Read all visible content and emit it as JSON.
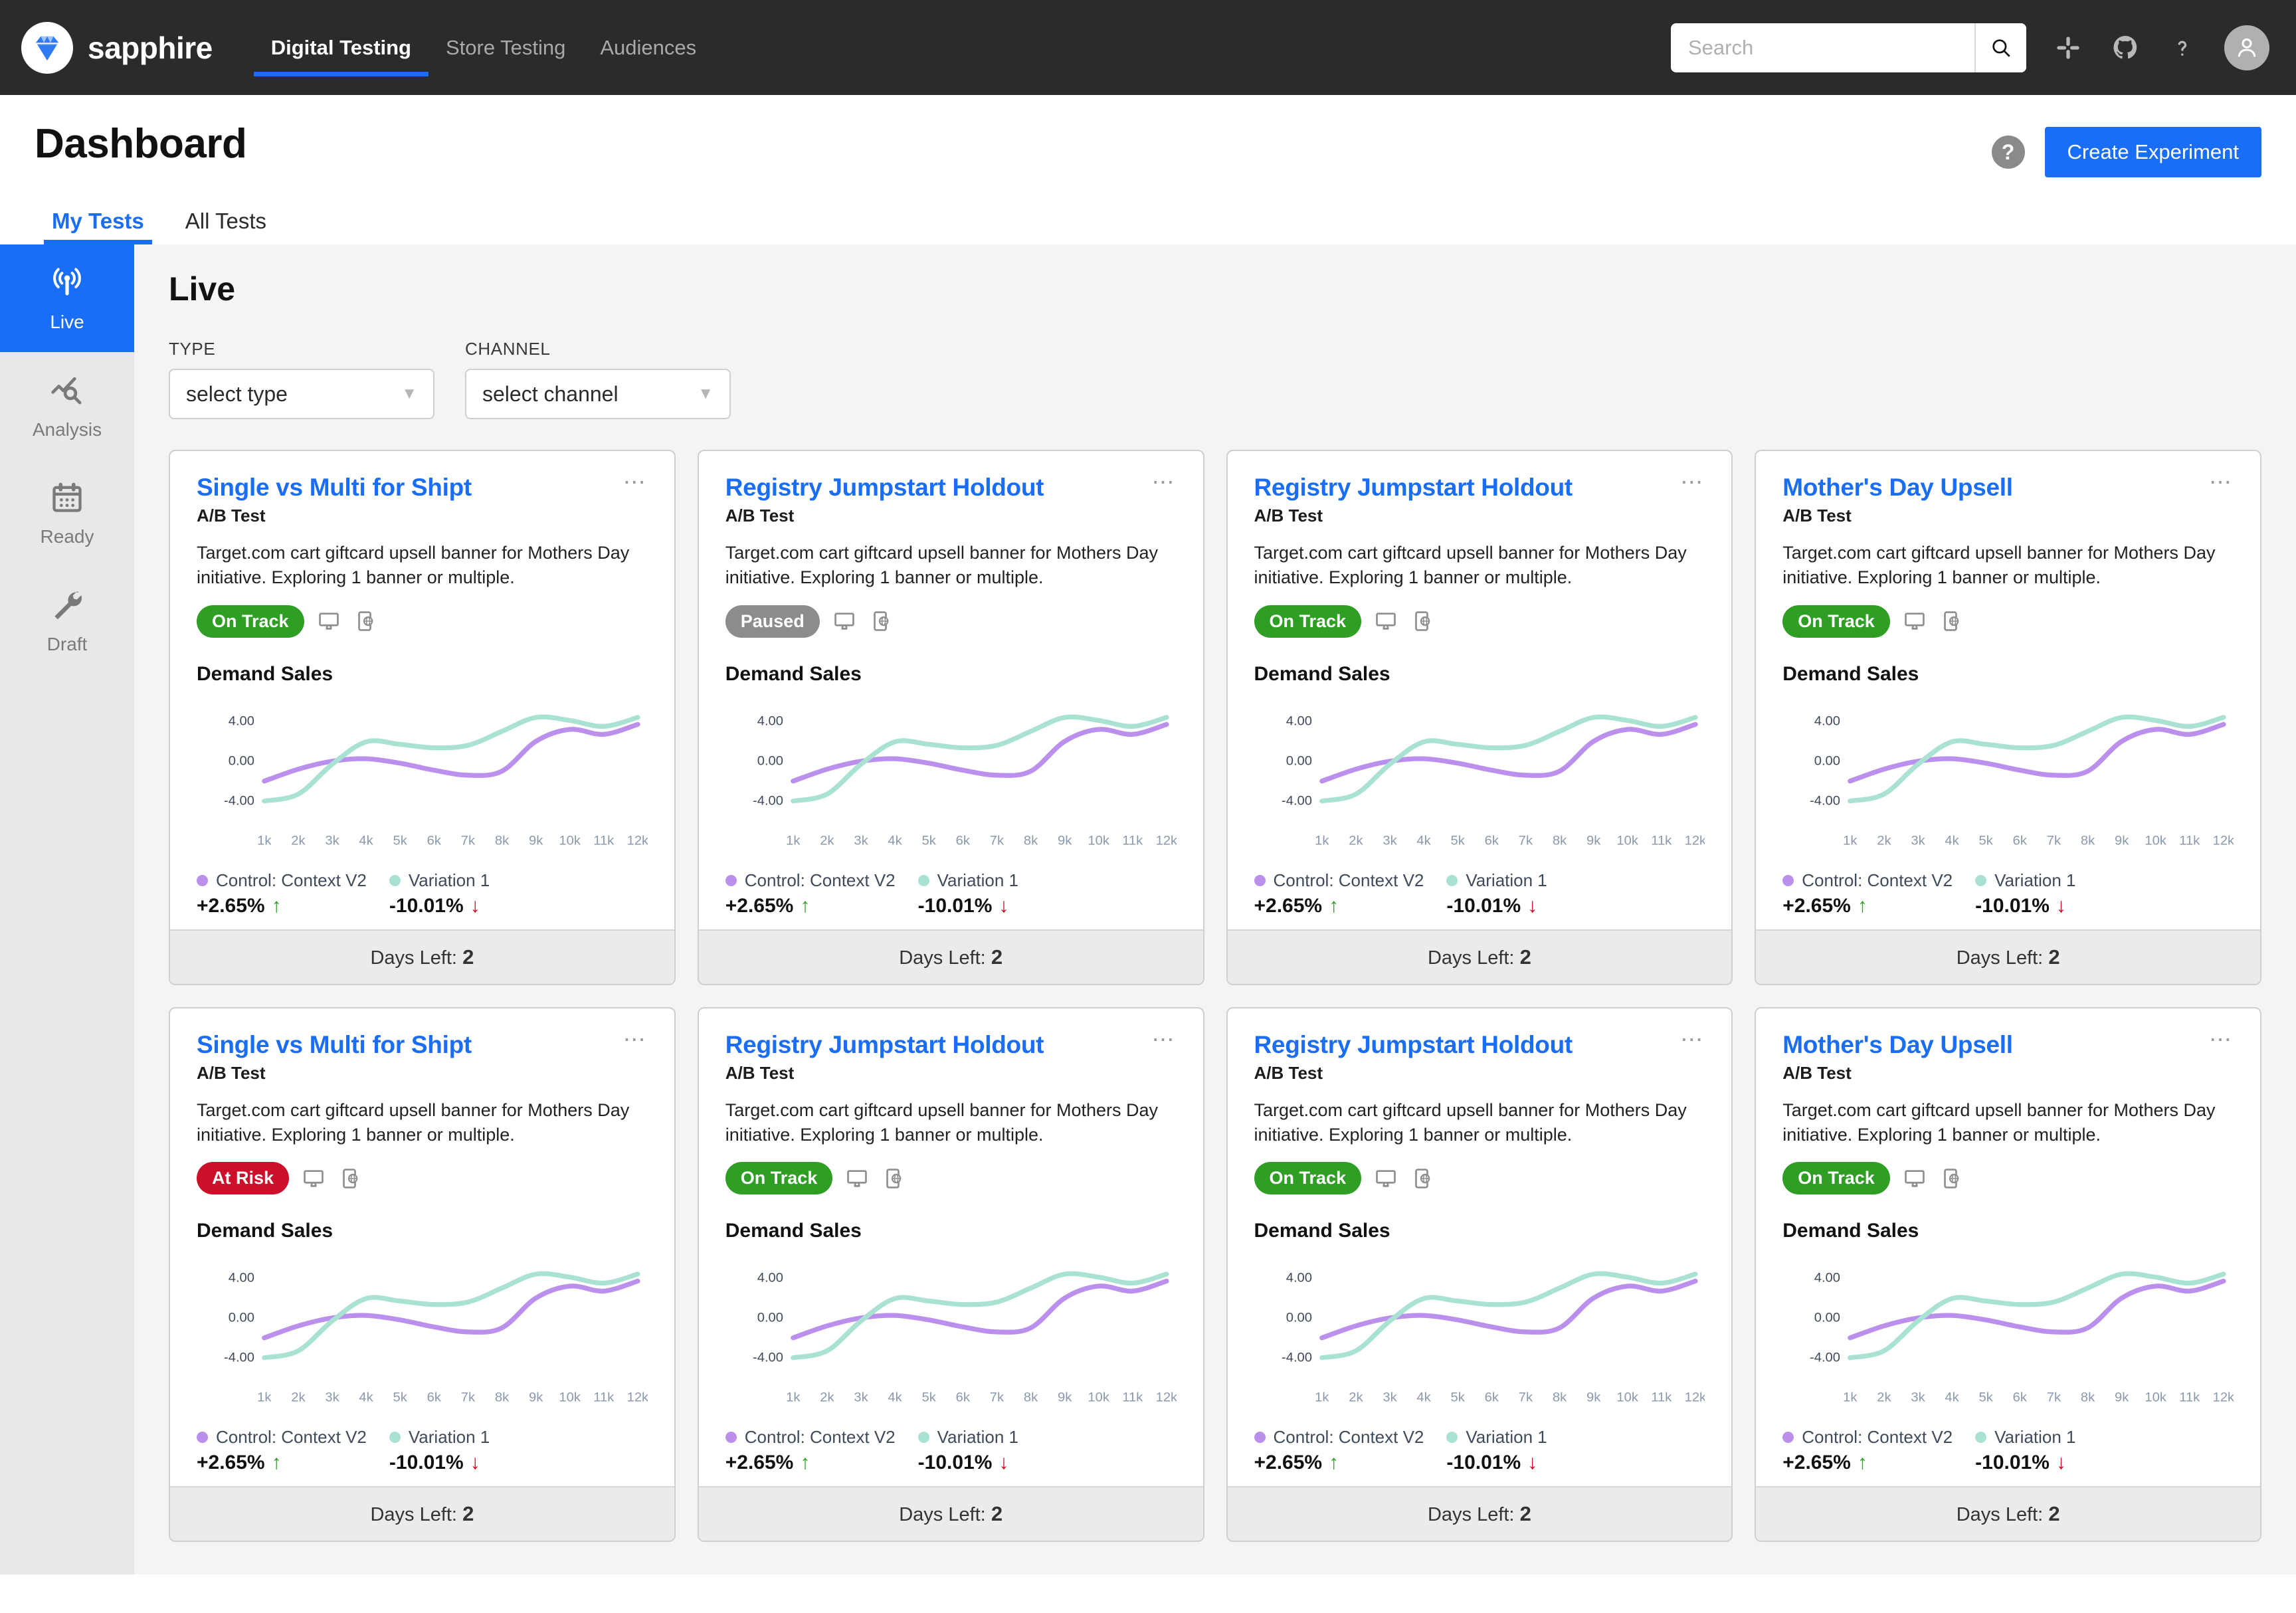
{
  "header": {
    "brand": "sapphire",
    "logo_icon": "diamond-icon",
    "nav_tabs": [
      {
        "label": "Digital Testing",
        "active": true
      },
      {
        "label": "Store Testing",
        "active": false
      },
      {
        "label": "Audiences",
        "active": false
      }
    ],
    "search": {
      "value": "",
      "placeholder": "Search",
      "icon": "search-icon"
    },
    "icons": [
      "slack-icon",
      "github-icon",
      "help-icon"
    ],
    "avatar_icon": "user-avatar-icon",
    "accent_color": "#1a6ef5",
    "bar_color": "#2b2b2b"
  },
  "page": {
    "title": "Dashboard",
    "help_label": "?",
    "create_button": "Create Experiment",
    "subtabs": [
      {
        "label": "My Tests",
        "active": true
      },
      {
        "label": "All Tests",
        "active": false
      }
    ]
  },
  "sidebar": {
    "items": [
      {
        "label": "Live",
        "icon": "broadcast-icon",
        "active": true
      },
      {
        "label": "Analysis",
        "icon": "chart-magnifier-icon",
        "active": false
      },
      {
        "label": "Ready",
        "icon": "calendar-icon",
        "active": false
      },
      {
        "label": "Draft",
        "icon": "wrench-icon",
        "active": false
      }
    ]
  },
  "main": {
    "section_title": "Live",
    "filters": [
      {
        "label": "TYPE",
        "value": "select type",
        "caret": "▼"
      },
      {
        "label": "CHANNEL",
        "value": "select channel",
        "caret": "▼"
      }
    ]
  },
  "chart_data": {
    "type": "line",
    "title": "Demand Sales",
    "xlabel": "",
    "ylabel": "",
    "x": [
      "1k",
      "2k",
      "3k",
      "4k",
      "5k",
      "6k",
      "7k",
      "8k",
      "9k",
      "10k",
      "11k",
      "12k"
    ],
    "yticks": [
      "4.00",
      "0.00",
      "-4.00"
    ],
    "ylim": [
      -6.0,
      6.0
    ],
    "grid": false,
    "legend_position": "bottom",
    "series": [
      {
        "name": "Control: Context V2",
        "color": "#bb8fec",
        "delta": "+2.65%",
        "direction": "up",
        "values": [
          -2.1,
          -0.9,
          -0.1,
          0.15,
          -0.3,
          -1.0,
          -1.5,
          -1.1,
          1.9,
          3.1,
          2.6,
          3.6
        ]
      },
      {
        "name": "Variation 1",
        "color": "#a9e2d3",
        "delta": "-10.01%",
        "direction": "down",
        "values": [
          -4.1,
          -3.4,
          -0.4,
          1.85,
          1.6,
          1.25,
          1.5,
          2.9,
          4.3,
          4.0,
          3.4,
          4.3
        ]
      }
    ]
  },
  "cards": [
    {
      "title": "Single vs Multi for Shipt",
      "type": "A/B Test",
      "description": "Target.com cart giftcard upsell banner for Mothers Day initiative. Exploring 1 banner or multiple.",
      "status": "On Track",
      "status_kind": "ontrack",
      "devices": [
        "desktop-icon",
        "mobile-web-icon"
      ],
      "metric": "Demand Sales",
      "control": {
        "name": "Control: Context V2",
        "delta": "+2.65%",
        "direction": "up"
      },
      "variation": {
        "name": "Variation 1",
        "delta": "-10.01%",
        "direction": "down"
      },
      "days_left_label": "Days Left:",
      "days_left": "2"
    },
    {
      "title": "Registry Jumpstart Holdout",
      "type": "A/B Test",
      "description": "Target.com cart giftcard upsell banner for Mothers Day initiative. Exploring 1 banner or multiple.",
      "status": "Paused",
      "status_kind": "paused",
      "devices": [
        "desktop-icon",
        "mobile-web-icon"
      ],
      "metric": "Demand Sales",
      "control": {
        "name": "Control: Context V2",
        "delta": "+2.65%",
        "direction": "up"
      },
      "variation": {
        "name": "Variation 1",
        "delta": "-10.01%",
        "direction": "down"
      },
      "days_left_label": "Days Left:",
      "days_left": "2"
    },
    {
      "title": "Registry Jumpstart Holdout",
      "type": "A/B Test",
      "description": "Target.com cart giftcard upsell banner for Mothers Day initiative. Exploring 1 banner or multiple.",
      "status": "On Track",
      "status_kind": "ontrack",
      "devices": [
        "desktop-icon",
        "mobile-web-icon"
      ],
      "metric": "Demand Sales",
      "control": {
        "name": "Control: Context V2",
        "delta": "+2.65%",
        "direction": "up"
      },
      "variation": {
        "name": "Variation 1",
        "delta": "-10.01%",
        "direction": "down"
      },
      "days_left_label": "Days Left:",
      "days_left": "2"
    },
    {
      "title": "Mother's Day Upsell",
      "type": "A/B Test",
      "description": "Target.com cart giftcard upsell banner for Mothers Day initiative. Exploring 1 banner or multiple.",
      "status": "On Track",
      "status_kind": "ontrack",
      "devices": [
        "desktop-icon",
        "mobile-web-icon"
      ],
      "metric": "Demand Sales",
      "control": {
        "name": "Control: Context V2",
        "delta": "+2.65%",
        "direction": "up"
      },
      "variation": {
        "name": "Variation 1",
        "delta": "-10.01%",
        "direction": "down"
      },
      "days_left_label": "Days Left:",
      "days_left": "2"
    },
    {
      "title": "Single vs Multi for Shipt",
      "type": "A/B Test",
      "description": "Target.com cart giftcard upsell banner for Mothers Day initiative. Exploring 1 banner or multiple.",
      "status": "At Risk",
      "status_kind": "atrisk",
      "devices": [
        "desktop-icon",
        "mobile-web-icon"
      ],
      "metric": "Demand Sales",
      "control": {
        "name": "Control: Context V2",
        "delta": "+2.65%",
        "direction": "up"
      },
      "variation": {
        "name": "Variation 1",
        "delta": "-10.01%",
        "direction": "down"
      },
      "days_left_label": "Days Left:",
      "days_left": "2"
    },
    {
      "title": "Registry Jumpstart Holdout",
      "type": "A/B Test",
      "description": "Target.com cart giftcard upsell banner for Mothers Day initiative. Exploring 1 banner or multiple.",
      "status": "On Track",
      "status_kind": "ontrack",
      "devices": [
        "desktop-icon",
        "mobile-web-icon"
      ],
      "metric": "Demand Sales",
      "control": {
        "name": "Control: Context V2",
        "delta": "+2.65%",
        "direction": "up"
      },
      "variation": {
        "name": "Variation 1",
        "delta": "-10.01%",
        "direction": "down"
      },
      "days_left_label": "Days Left:",
      "days_left": "2"
    },
    {
      "title": "Registry Jumpstart Holdout",
      "type": "A/B Test",
      "description": "Target.com cart giftcard upsell banner for Mothers Day initiative. Exploring 1 banner or multiple.",
      "status": "On Track",
      "status_kind": "ontrack",
      "devices": [
        "desktop-icon",
        "mobile-web-icon"
      ],
      "metric": "Demand Sales",
      "control": {
        "name": "Control: Context V2",
        "delta": "+2.65%",
        "direction": "up"
      },
      "variation": {
        "name": "Variation 1",
        "delta": "-10.01%",
        "direction": "down"
      },
      "days_left_label": "Days Left:",
      "days_left": "2"
    },
    {
      "title": "Mother's Day Upsell",
      "type": "A/B Test",
      "description": "Target.com cart giftcard upsell banner for Mothers Day initiative. Exploring 1 banner or multiple.",
      "status": "On Track",
      "status_kind": "ontrack",
      "devices": [
        "desktop-icon",
        "mobile-web-icon"
      ],
      "metric": "Demand Sales",
      "control": {
        "name": "Control: Context V2",
        "delta": "+2.65%",
        "direction": "up"
      },
      "variation": {
        "name": "Variation 1",
        "delta": "-10.01%",
        "direction": "down"
      },
      "days_left_label": "Days Left:",
      "days_left": "2"
    }
  ]
}
